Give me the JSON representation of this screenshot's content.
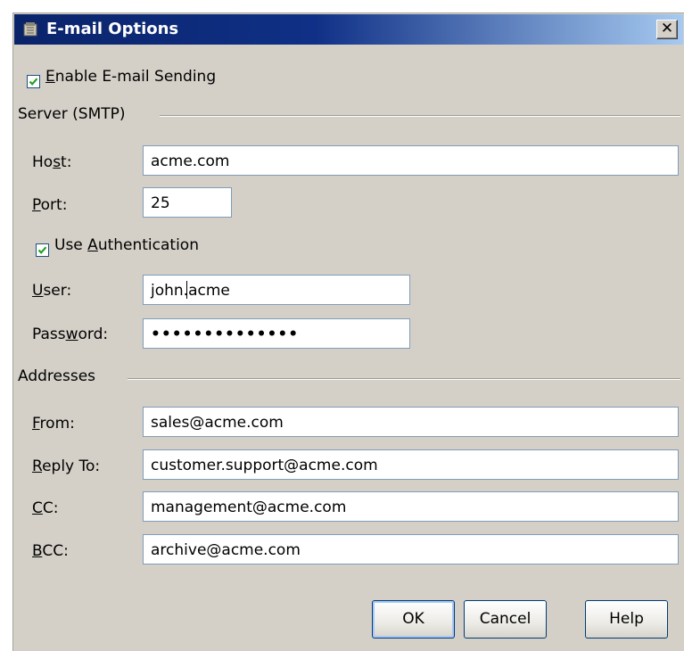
{
  "window": {
    "title": "E-mail Options",
    "close_glyph": "✕"
  },
  "enable_sending": {
    "label_pre": "",
    "accel": "E",
    "label_post": "nable E-mail Sending",
    "checked": true
  },
  "sections": {
    "server": "Server (SMTP)",
    "addresses": "Addresses"
  },
  "host": {
    "label_pre": "Ho",
    "accel": "s",
    "label_post": "t:",
    "value": "acme.com"
  },
  "port": {
    "label_pre": "",
    "accel": "P",
    "label_post": "ort:",
    "value": "25"
  },
  "use_auth": {
    "label_pre": "Use ",
    "accel": "A",
    "label_post": "uthentication",
    "checked": true
  },
  "user": {
    "label_pre": "",
    "accel": "U",
    "label_post": "ser:",
    "value": "john.acme"
  },
  "password": {
    "label_pre": "Pass",
    "accel": "w",
    "label_post": "ord:",
    "value": "••••••••••••••"
  },
  "from": {
    "label_pre": "",
    "accel": "F",
    "label_post": "rom:",
    "value": "sales@acme.com"
  },
  "reply_to": {
    "label_pre": "",
    "accel": "R",
    "label_post": "eply To:",
    "value": "customer.support@acme.com"
  },
  "cc": {
    "label_pre": "",
    "accel": "C",
    "label_post": "C:",
    "value": "management@acme.com"
  },
  "bcc": {
    "label_pre": "",
    "accel": "B",
    "label_post": "CC:",
    "value": "archive@acme.com"
  },
  "buttons": {
    "ok": "OK",
    "cancel": "Cancel",
    "help": "Help"
  },
  "colors": {
    "title_start": "#0a246a",
    "title_end": "#a6caf0",
    "dialog_bg": "#d4d0c8",
    "check": "#21a121"
  }
}
